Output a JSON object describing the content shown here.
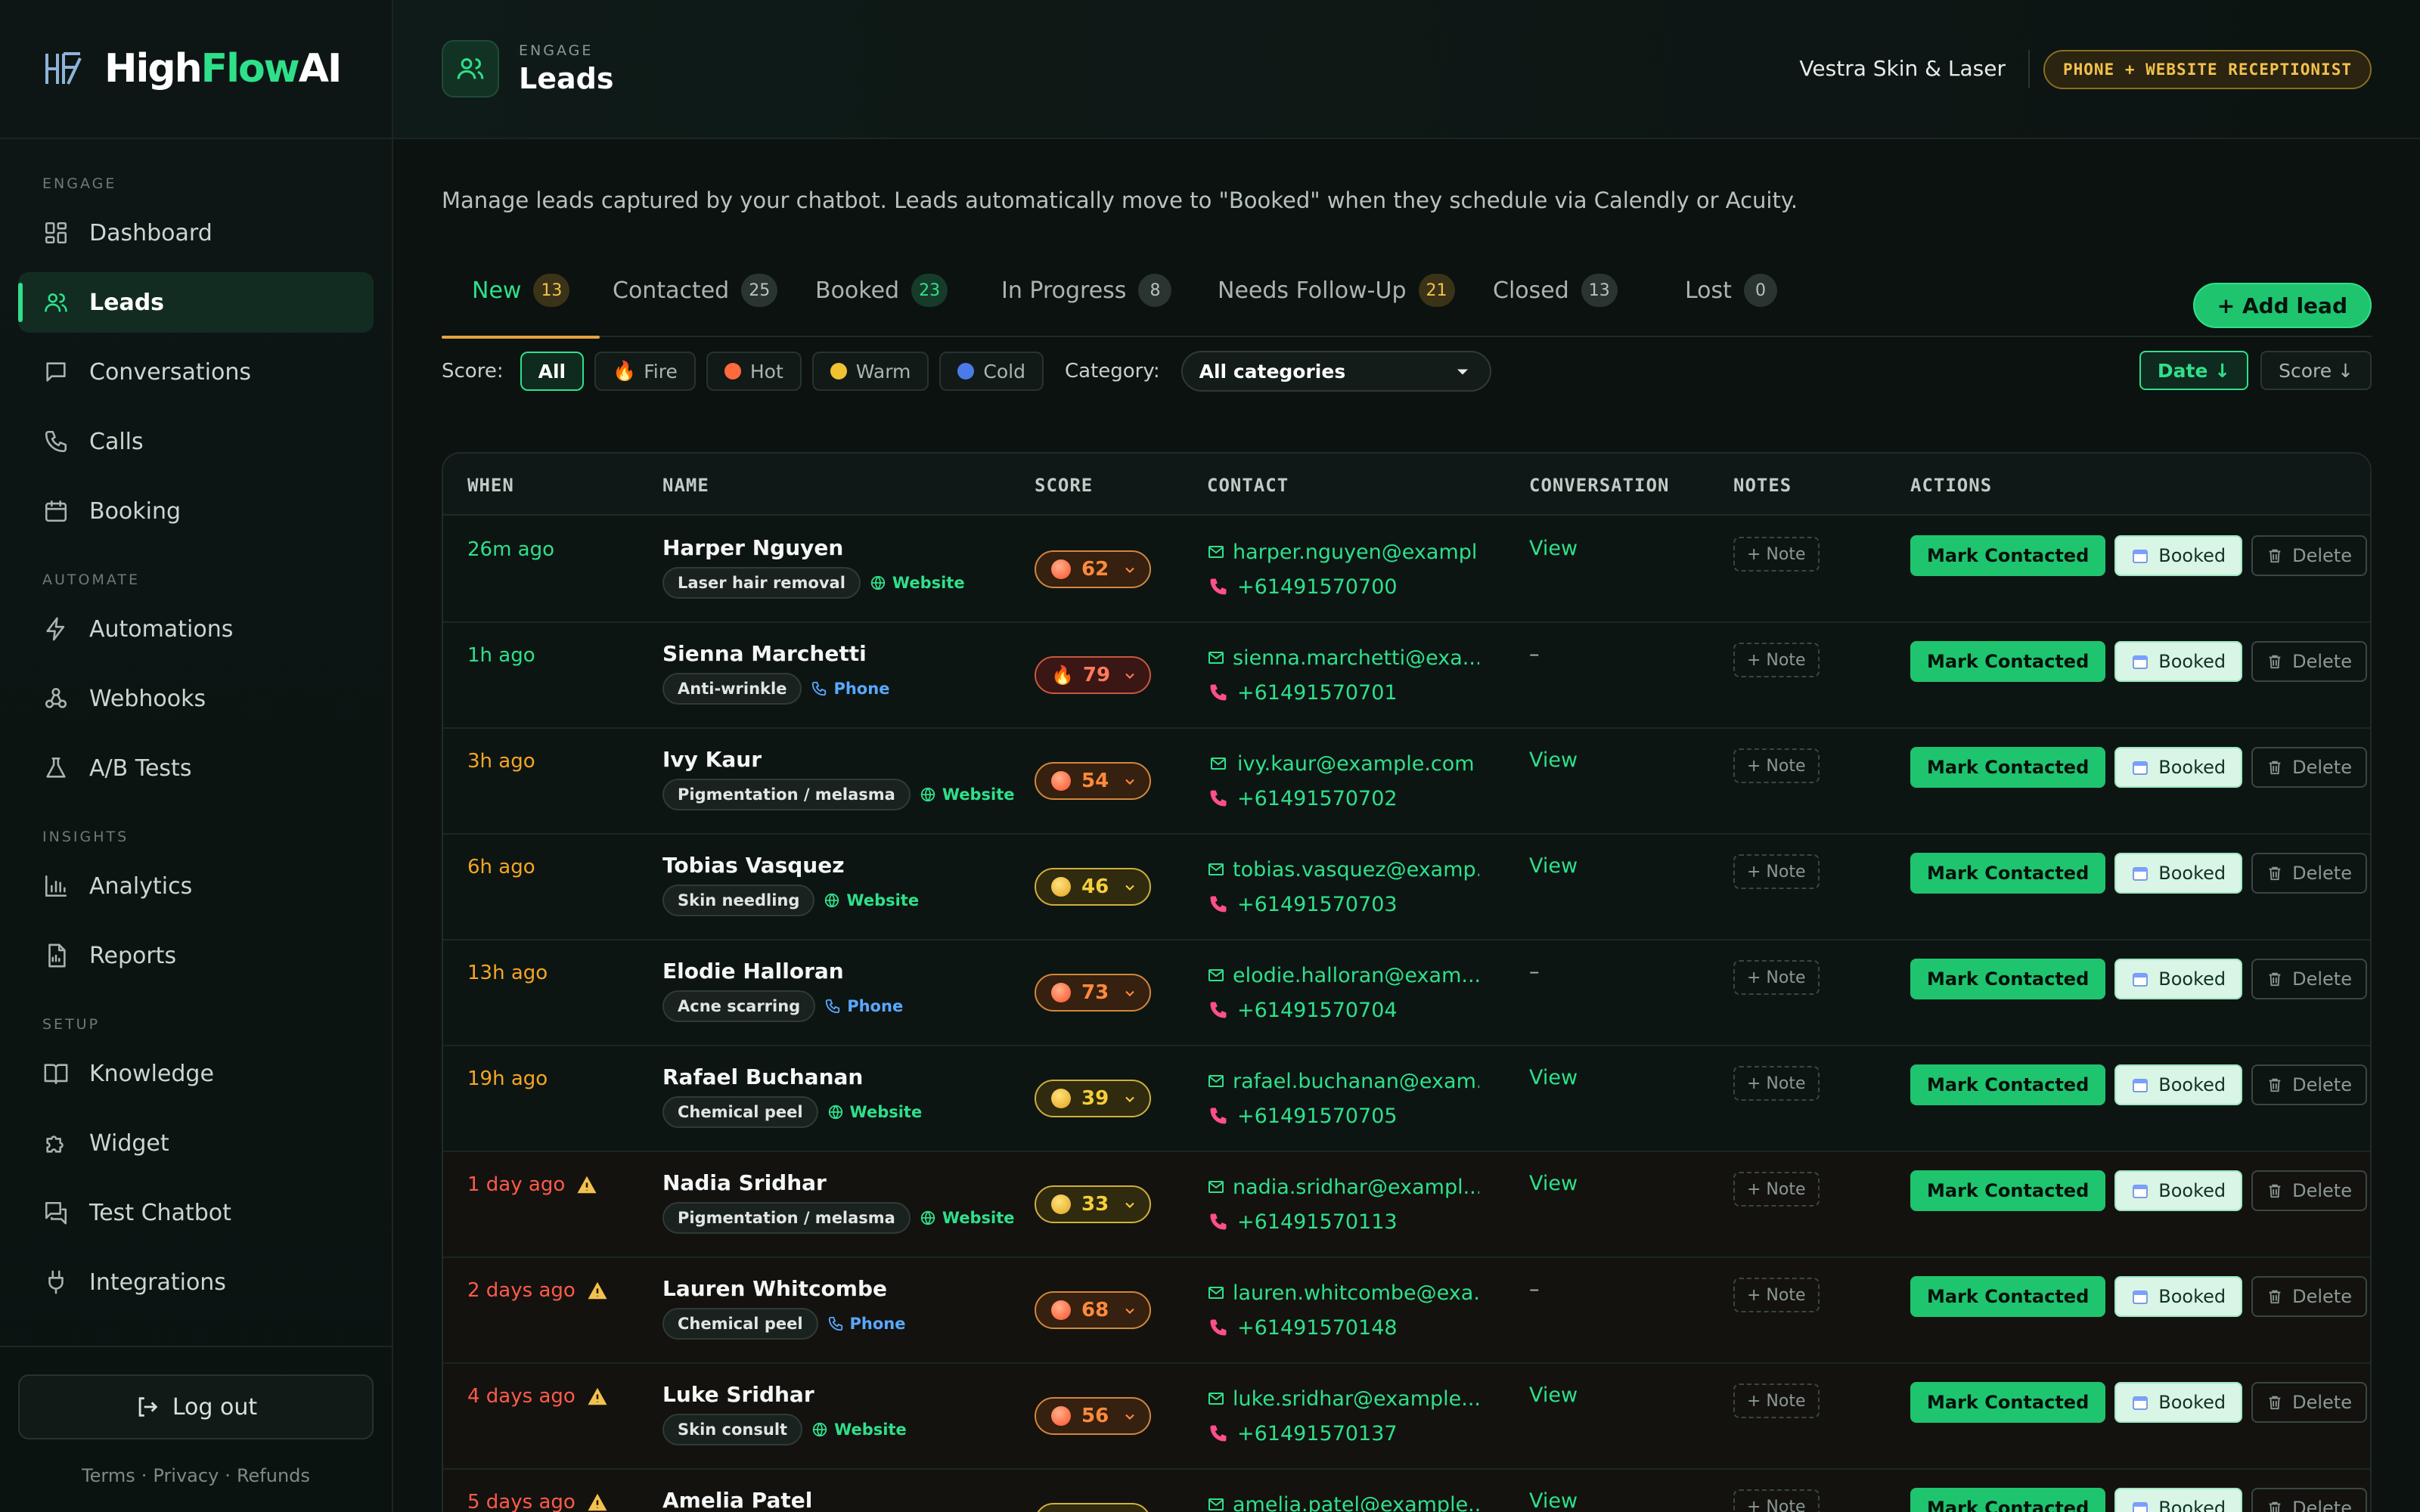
{
  "brand": {
    "name_a": "High",
    "name_b": "Flow",
    "name_c": "AI"
  },
  "sidebar": {
    "sections": [
      {
        "label": "ENGAGE",
        "items": [
          {
            "label": "Dashboard",
            "icon": "grid-icon"
          },
          {
            "label": "Leads",
            "icon": "users-icon",
            "active": true
          },
          {
            "label": "Conversations",
            "icon": "chat-icon"
          },
          {
            "label": "Calls",
            "icon": "phone-icon"
          },
          {
            "label": "Booking",
            "icon": "calendar-icon"
          }
        ]
      },
      {
        "label": "AUTOMATE",
        "items": [
          {
            "label": "Automations",
            "icon": "bolt-icon"
          },
          {
            "label": "Webhooks",
            "icon": "webhook-icon"
          },
          {
            "label": "A/B Tests",
            "icon": "flask-icon"
          }
        ]
      },
      {
        "label": "INSIGHTS",
        "items": [
          {
            "label": "Analytics",
            "icon": "bar-chart-icon"
          },
          {
            "label": "Reports",
            "icon": "report-icon"
          }
        ]
      },
      {
        "label": "SETUP",
        "items": [
          {
            "label": "Knowledge",
            "icon": "book-icon"
          },
          {
            "label": "Widget",
            "icon": "puzzle-icon"
          },
          {
            "label": "Test Chatbot",
            "icon": "chat-test-icon"
          },
          {
            "label": "Integrations",
            "icon": "plug-icon"
          }
        ]
      }
    ],
    "logout": "Log out",
    "legal": [
      "Terms",
      "Privacy",
      "Refunds"
    ]
  },
  "header": {
    "crumb": "ENGAGE",
    "title": "Leads",
    "client": "Vestra Skin & Laser",
    "plan_badge": "PHONE + WEBSITE RECEPTIONIST"
  },
  "description": "Manage leads captured by your chatbot. Leads automatically move to \"Booked\" when they schedule via Calendly or Acuity.",
  "tabs": [
    {
      "label": "New",
      "count": "13"
    },
    {
      "label": "Contacted",
      "count": "25"
    },
    {
      "label": "Booked",
      "count": "23"
    },
    {
      "label": "In Progress",
      "count": "8"
    },
    {
      "label": "Needs Follow-Up",
      "count": "21"
    },
    {
      "label": "Closed",
      "count": "13"
    },
    {
      "label": "Lost",
      "count": "0"
    }
  ],
  "add_lead": "+ Add lead",
  "filters": {
    "score_label": "Score:",
    "chips": [
      {
        "label": "All"
      },
      {
        "label": "Fire"
      },
      {
        "label": "Hot"
      },
      {
        "label": "Warm"
      },
      {
        "label": "Cold"
      }
    ],
    "category_label": "Category:",
    "category_value": "All categories",
    "sort": [
      {
        "label": "Date ↓"
      },
      {
        "label": "Score ↓"
      }
    ]
  },
  "table": {
    "headers": [
      "WHEN",
      "NAME",
      "SCORE",
      "CONTACT",
      "CONVERSATION",
      "NOTES",
      "ACTIONS"
    ],
    "note_label": "+ Note",
    "mark_label": "Mark Contacted",
    "booked_label": "Booked",
    "delete_label": "Delete",
    "rows": [
      {
        "when": "26m ago",
        "tone": "green",
        "name": "Harper Nguyen",
        "tag": "Laser hair removal",
        "source": "Website",
        "score": "62",
        "level": "hot",
        "email": "harper.nguyen@exampl...",
        "phone": "+61491570700",
        "conv": "View"
      },
      {
        "when": "1h ago",
        "tone": "green",
        "name": "Sienna Marchetti",
        "tag": "Anti-wrinkle",
        "source": "Phone",
        "score": "79",
        "level": "fire",
        "email": "sienna.marchetti@exa...",
        "phone": "+61491570701",
        "conv": "–"
      },
      {
        "when": "3h ago",
        "tone": "amber",
        "name": "Ivy Kaur",
        "tag": "Pigmentation / melasma",
        "source": "Website",
        "score": "54",
        "level": "hot",
        "email": "ivy.kaur@example.com",
        "phone": "+61491570702",
        "conv": "View"
      },
      {
        "when": "6h ago",
        "tone": "amber",
        "name": "Tobias Vasquez",
        "tag": "Skin needling",
        "source": "Website",
        "score": "46",
        "level": "warm",
        "email": "tobias.vasquez@examp...",
        "phone": "+61491570703",
        "conv": "View"
      },
      {
        "when": "13h ago",
        "tone": "amber",
        "name": "Elodie Halloran",
        "tag": "Acne scarring",
        "source": "Phone",
        "score": "73",
        "level": "hot",
        "email": "elodie.halloran@exam...",
        "phone": "+61491570704",
        "conv": "–"
      },
      {
        "when": "19h ago",
        "tone": "amber",
        "name": "Rafael Buchanan",
        "tag": "Chemical peel",
        "source": "Website",
        "score": "39",
        "level": "warm",
        "email": "rafael.buchanan@exam...",
        "phone": "+61491570705",
        "conv": "View"
      },
      {
        "when": "1 day ago",
        "tone": "red",
        "warn": true,
        "name": "Nadia Sridhar",
        "tag": "Pigmentation / melasma",
        "source": "Website",
        "score": "33",
        "level": "warm",
        "email": "nadia.sridhar@exampl...",
        "phone": "+61491570113",
        "conv": "View"
      },
      {
        "when": "2 days ago",
        "tone": "red",
        "warn": true,
        "name": "Lauren Whitcombe",
        "tag": "Chemical peel",
        "source": "Phone",
        "score": "68",
        "level": "hot",
        "email": "lauren.whitcombe@exa...",
        "phone": "+61491570148",
        "conv": "–"
      },
      {
        "when": "4 days ago",
        "tone": "red",
        "warn": true,
        "name": "Luke Sridhar",
        "tag": "Skin consult",
        "source": "Website",
        "score": "56",
        "level": "hot",
        "email": "luke.sridhar@example...",
        "phone": "+61491570137",
        "conv": "View"
      },
      {
        "when": "5 days ago",
        "tone": "red",
        "warn": true,
        "name": "Amelia Patel",
        "tag": "",
        "source": "",
        "score": "",
        "level": "warm",
        "email": "amelia.patel@example...",
        "phone": "",
        "conv": "View"
      }
    ]
  },
  "colors": {
    "accent": "#2fe08a",
    "fire": "#ff5a4a",
    "hot": "#ff7a3d",
    "warm": "#f0c232",
    "cold": "#4a7be8"
  }
}
